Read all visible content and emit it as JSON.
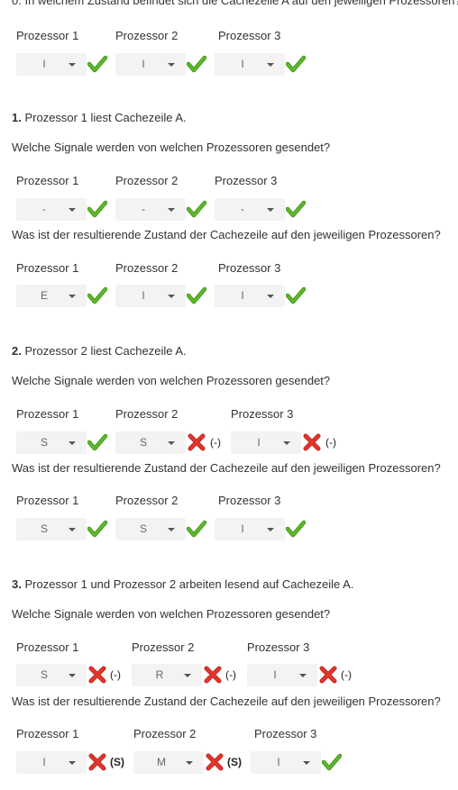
{
  "top": {
    "cut_text": "0. In welchem Zustand befindet sich die Cachezeile A auf den jeweiligen Prozessoren?",
    "labels": [
      "Prozessor 1",
      "Prozessor 2",
      "Prozessor 3"
    ],
    "values": [
      "I",
      "I",
      "I"
    ]
  },
  "steps": [
    {
      "num": "1.",
      "title": "Prozessor 1 liest Cachezeile A.",
      "signals_question": "Welche Signale werden von welchen Prozessoren gesendet?",
      "signals_labels": [
        "Prozessor 1",
        "Prozessor 2",
        "Prozessor 3"
      ],
      "signals_values": [
        "-",
        "-",
        "-"
      ],
      "signals_feedback": [
        "",
        "",
        ""
      ],
      "state_question": "Was ist der resultierende Zustand der Cachezeile auf den jeweiligen Prozessoren?",
      "state_labels": [
        "Prozessor 1",
        "Prozessor 2",
        "Prozessor 3"
      ],
      "state_values": [
        "E",
        "I",
        "I"
      ],
      "state_feedback": [
        "",
        "",
        ""
      ]
    },
    {
      "num": "2.",
      "title": "Prozessor 2 liest Cachezeile A.",
      "signals_question": "Welche Signale werden von welchen Prozessoren gesendet?",
      "signals_labels": [
        "Prozessor 1",
        "Prozessor 2",
        "Prozessor 3"
      ],
      "signals_values": [
        "S",
        "S",
        "I"
      ],
      "signals_feedback": [
        "",
        "(-)",
        "(-)"
      ],
      "state_question": "Was ist der resultierende Zustand der Cachezeile auf den jeweiligen Prozessoren?",
      "state_labels": [
        "Prozessor 1",
        "Prozessor 2",
        "Prozessor 3"
      ],
      "state_values": [
        "S",
        "S",
        "I"
      ],
      "state_feedback": [
        "",
        "",
        ""
      ]
    },
    {
      "num": "3.",
      "title": "Prozessor 1 und Prozessor 2 arbeiten lesend auf Cachezeile A.",
      "signals_question": "Welche Signale werden von welchen Prozessoren gesendet?",
      "signals_labels": [
        "Prozessor 1",
        "Prozessor 2",
        "Prozessor 3"
      ],
      "signals_values": [
        "S",
        "R",
        "I"
      ],
      "signals_feedback": [
        "(-)",
        "(-)",
        "(-)"
      ],
      "state_question": "Was ist der resultierende Zustand der Cachezeile auf den jeweiligen Prozessoren?",
      "state_labels": [
        "Prozessor 1",
        "Prozessor 2",
        "Prozessor 3"
      ],
      "state_values": [
        "I",
        "M",
        "I"
      ],
      "state_feedback": [
        "(S)",
        "(S)",
        ""
      ]
    }
  ],
  "icons": {
    "correct": "check-icon",
    "wrong": "cross-icon"
  },
  "colors": {
    "correct": "#5cb82a",
    "wrong": "#e0352b",
    "select_bg": "#f3f3f3"
  }
}
